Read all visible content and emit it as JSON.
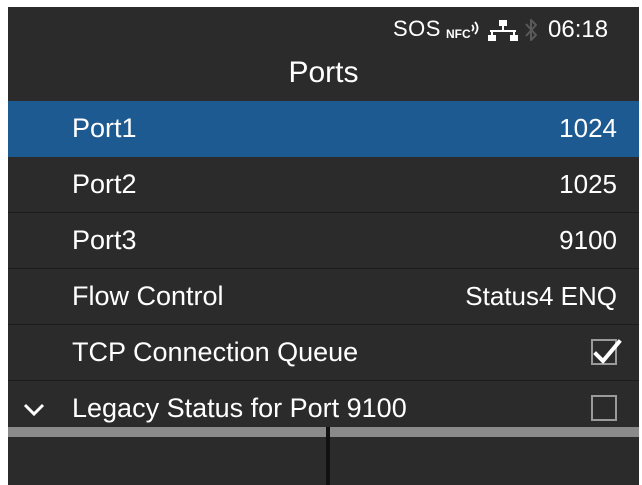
{
  "status_bar": {
    "sos": "SOS",
    "nfc_icon": "nfc-icon",
    "network_icon": "network-icon",
    "bluetooth_icon": "bluetooth-icon",
    "time": "06:18"
  },
  "title": "Ports",
  "colors": {
    "background": "#2b2b2b",
    "selected": "#1d5a92",
    "softkey_bar": "#8a8a8a"
  },
  "items": [
    {
      "label": "Port1",
      "value": "1024",
      "selected": true
    },
    {
      "label": "Port2",
      "value": "1025"
    },
    {
      "label": "Port3",
      "value": "9100"
    },
    {
      "label": "Flow Control",
      "value": "Status4 ENQ"
    },
    {
      "label": "TCP Connection Queue",
      "checked": true
    },
    {
      "label": "Legacy Status for Port 9100",
      "checked": false
    }
  ]
}
